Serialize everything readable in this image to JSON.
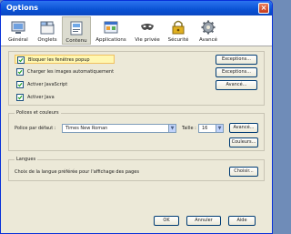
{
  "window": {
    "title": "Options",
    "close_label": "×"
  },
  "toolbar": {
    "items": [
      {
        "label": "Général",
        "icon": "general-icon"
      },
      {
        "label": "Onglets",
        "icon": "tabs-icon"
      },
      {
        "label": "Contenu",
        "icon": "content-icon",
        "active": true
      },
      {
        "label": "Applications",
        "icon": "applications-icon"
      },
      {
        "label": "Vie privée",
        "icon": "privacy-mask-icon"
      },
      {
        "label": "Sécurité",
        "icon": "security-lock-icon"
      },
      {
        "label": "Avancé",
        "icon": "advanced-gear-icon"
      }
    ]
  },
  "content": {
    "popup": {
      "label": "Bloquer les fenêtres popup",
      "checked": true,
      "button": "Exceptions..."
    },
    "images": {
      "label": "Charger les images automatiquement",
      "checked": true,
      "button": "Exceptions..."
    },
    "javascript": {
      "label": "Activer JavaScript",
      "checked": true,
      "button": "Avancé..."
    },
    "java": {
      "label": "Activer Java",
      "checked": true
    }
  },
  "fonts": {
    "group_title": "Polices et couleurs",
    "default_font_label": "Police par défaut :",
    "default_font_value": "Times New Roman",
    "size_label": "Taille :",
    "size_value": "16",
    "advanced_button": "Avancé...",
    "colors_button": "Couleurs..."
  },
  "languages": {
    "group_title": "Langues",
    "description": "Choix de la langue préférée pour l'affichage des pages",
    "choose_button": "Choisir..."
  },
  "footer": {
    "ok": "OK",
    "cancel": "Annuler",
    "help": "Aide"
  },
  "colors": {
    "titlebar": "#0a52d4",
    "highlight": "#fff7b0",
    "panel": "#ece9d8"
  }
}
